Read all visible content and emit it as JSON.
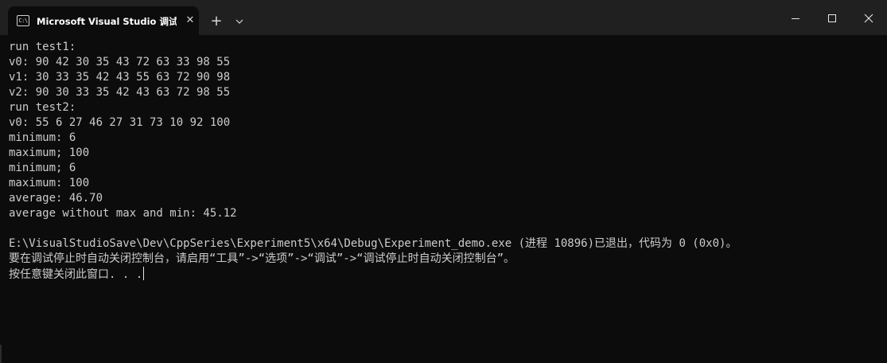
{
  "window": {
    "tab_icon_text": "C:\\",
    "tab_title": "Microsoft Visual Studio 调试控",
    "new_tab_symbol": "+",
    "close_symbol": "✕"
  },
  "console": {
    "lines": [
      "run test1:",
      "v0: 90 42 30 35 43 72 63 33 98 55",
      "v1: 30 33 35 42 43 55 63 72 90 98",
      "v2: 90 30 33 35 42 43 63 72 98 55",
      "run test2:",
      "v0: 55 6 27 46 27 31 73 10 92 100",
      "minimum: 6",
      "maximum; 100",
      "minimum; 6",
      "maximum: 100",
      "average: 46.70",
      "average without max and min: 45.12",
      "",
      "E:\\VisualStudioSave\\Dev\\CppSeries\\Experiment5\\x64\\Debug\\Experiment_demo.exe (进程 10896)已退出，代码为 0 (0x0)。",
      "要在调试停止时自动关闭控制台，请启用“工具”->“选项”->“调试”->“调试停止时自动关闭控制台”。",
      "按任意键关闭此窗口. . ."
    ]
  },
  "colors": {
    "console_background": "#0c0c0c",
    "titlebar_background": "#202020",
    "console_text": "#cccccc",
    "title_text": "#ffffff"
  },
  "icons": {
    "tab_icon": "terminal-icon",
    "dropdown": "chevron-down-icon",
    "minimize": "minimize-icon",
    "maximize": "maximize-icon",
    "close": "close-icon"
  }
}
